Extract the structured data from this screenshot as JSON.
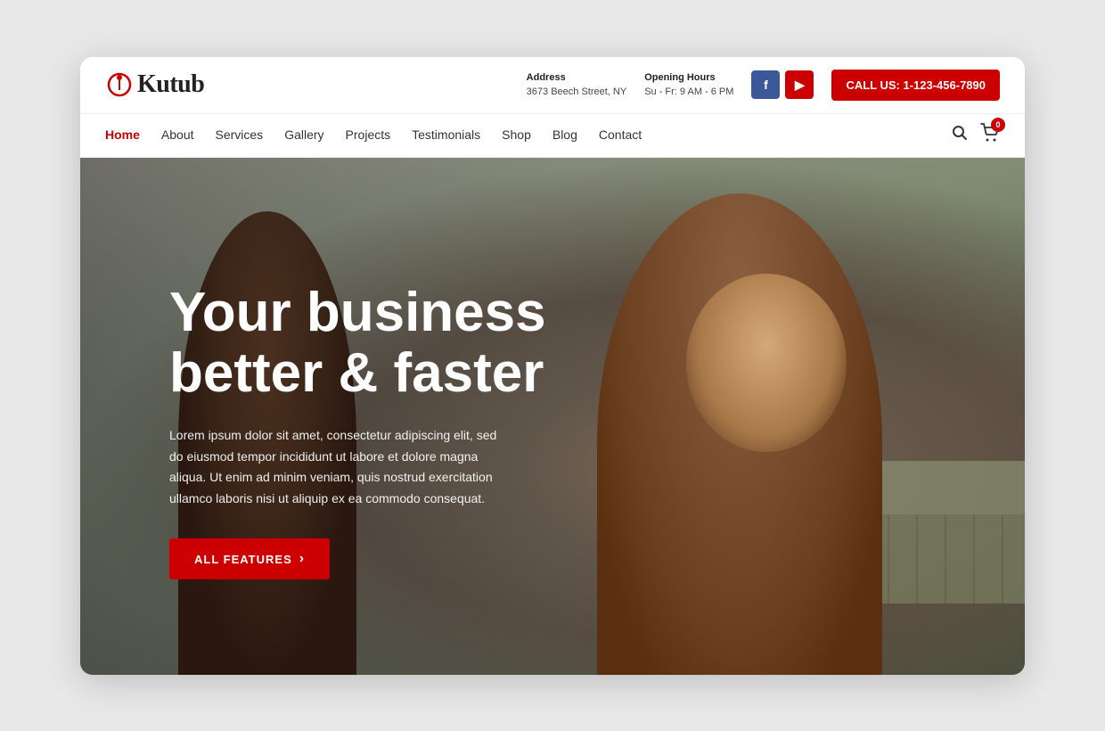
{
  "logo": {
    "text": "Kutub"
  },
  "topbar": {
    "address_label": "Address",
    "address_value": "3673 Beech Street, NY",
    "hours_label": "Opening Hours",
    "hours_value": "Su - Fr: 9 AM - 6 PM",
    "call_label": "CALL US: 1-123-456-7890",
    "facebook_label": "f",
    "youtube_label": "▶"
  },
  "nav": {
    "items": [
      {
        "label": "Home",
        "active": true
      },
      {
        "label": "About",
        "active": false
      },
      {
        "label": "Services",
        "active": false
      },
      {
        "label": "Gallery",
        "active": false
      },
      {
        "label": "Projects",
        "active": false
      },
      {
        "label": "Testimonials",
        "active": false
      },
      {
        "label": "Shop",
        "active": false
      },
      {
        "label": "Blog",
        "active": false
      },
      {
        "label": "Contact",
        "active": false
      }
    ],
    "cart_count": "0"
  },
  "hero": {
    "title_line1": "Your business",
    "title_line2": "better & faster",
    "description": "Lorem ipsum dolor sit amet, consectetur adipiscing elit, sed do eiusmod tempor incididunt ut labore et dolore magna aliqua. Ut enim ad minim veniam, quis nostrud exercitation ullamco laboris nisi ut aliquip ex ea commodo consequat.",
    "cta_label": "ALL FEATURES",
    "cta_arrow": "›"
  }
}
